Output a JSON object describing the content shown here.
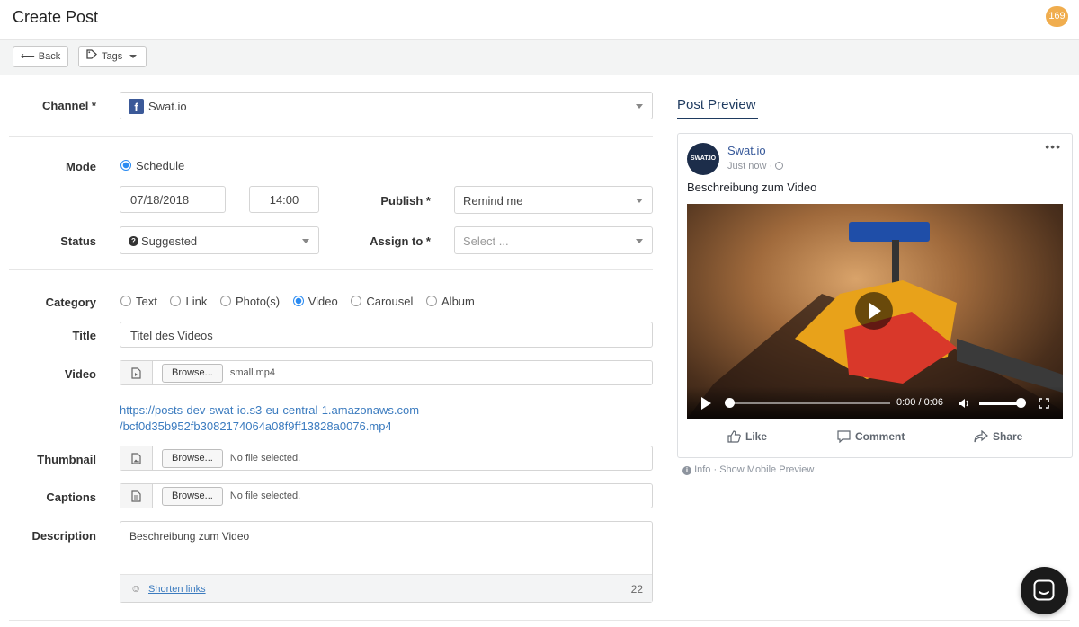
{
  "header": {
    "title": "Create Post",
    "count": "169"
  },
  "toolbar": {
    "back": "Back",
    "tags": "Tags"
  },
  "form": {
    "channel": {
      "label": "Channel *",
      "value": "Swat.io"
    },
    "mode": {
      "label": "Mode",
      "option": "Schedule"
    },
    "date": "07/18/2018",
    "time": "14:00",
    "publish": {
      "label": "Publish *",
      "value": "Remind me"
    },
    "status": {
      "label": "Status",
      "value": "Suggested"
    },
    "assign": {
      "label": "Assign to *",
      "placeholder": "Select ..."
    },
    "category": {
      "label": "Category",
      "options": [
        "Text",
        "Link",
        "Photo(s)",
        "Video",
        "Carousel",
        "Album"
      ],
      "selected": "Video"
    },
    "title": {
      "label": "Title",
      "value": "Titel des Videos"
    },
    "video": {
      "label": "Video",
      "browse": "Browse...",
      "file": "small.mp4",
      "url_line1": "https://posts-dev-swat-io.s3-eu-central-1.amazonaws.com",
      "url_line2": "/bcf0d35b952fb3082174064a08f9ff13828a0076.mp4"
    },
    "thumbnail": {
      "label": "Thumbnail",
      "browse": "Browse...",
      "file": "No file selected."
    },
    "captions": {
      "label": "Captions",
      "browse": "Browse...",
      "file": "No file selected."
    },
    "description": {
      "label": "Description",
      "value": "Beschreibung zum Video",
      "shorten_links": "Shorten links",
      "char_count": "22"
    }
  },
  "preview": {
    "title": "Post Preview",
    "page_name": "Swat.io",
    "avatar_text": "SWAT.IO",
    "time": "Just now ·",
    "description": "Beschreibung zum Video",
    "video_time": "0:00 / 0:06",
    "actions": {
      "like": "Like",
      "comment": "Comment",
      "share": "Share"
    },
    "info": "Info",
    "mobile_preview": "· Show Mobile Preview"
  },
  "colors": {
    "accent": "#2a8bf2",
    "badge": "#f0ad4e",
    "facebook": "#3b5998",
    "link": "#3b7bbf"
  }
}
